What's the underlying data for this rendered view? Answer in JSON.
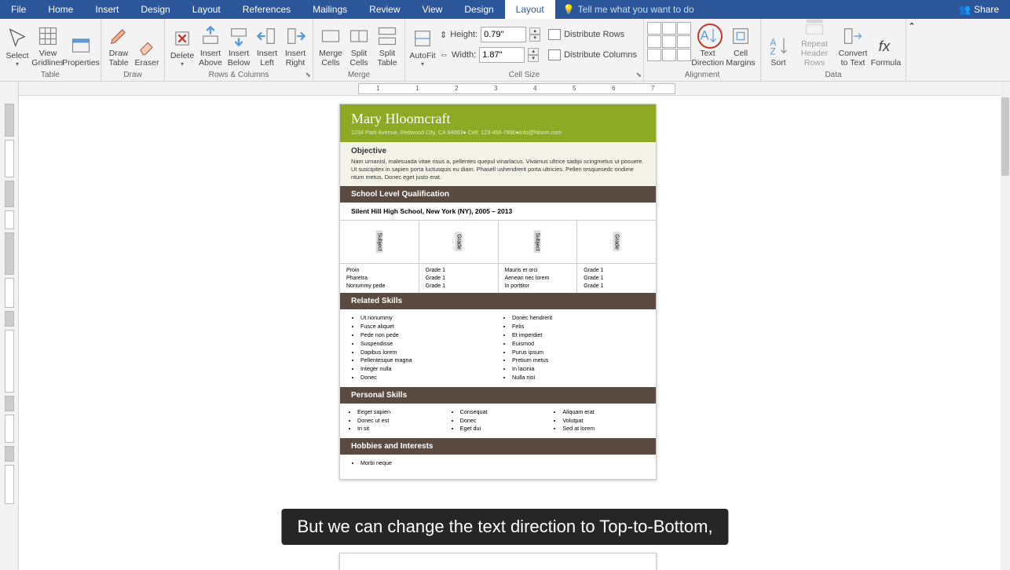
{
  "menu": {
    "tabs": [
      "File",
      "Home",
      "Insert",
      "Design",
      "Layout",
      "References",
      "Mailings",
      "Review",
      "View",
      "Design",
      "Layout"
    ],
    "tellme": "Tell me what you want to do",
    "share": "Share"
  },
  "ribbon": {
    "table": {
      "select": "Select",
      "gridlines": "View\nGridlines",
      "properties": "Properties",
      "label": "Table"
    },
    "draw": {
      "draw": "Draw\nTable",
      "eraser": "Eraser",
      "label": "Draw"
    },
    "rowscols": {
      "delete": "Delete",
      "above": "Insert\nAbove",
      "below": "Insert\nBelow",
      "left": "Insert\nLeft",
      "right": "Insert\nRight",
      "label": "Rows & Columns"
    },
    "merge": {
      "merge": "Merge\nCells",
      "split": "Split\nCells",
      "splittbl": "Split\nTable",
      "label": "Merge"
    },
    "cellsize": {
      "autofit": "AutoFit",
      "height": "Height:",
      "width": "Width:",
      "h_val": "0.79\"",
      "w_val": "1.87\"",
      "distrows": "Distribute Rows",
      "distcols": "Distribute Columns",
      "label": "Cell Size"
    },
    "align": {
      "textdir": "Text\nDirection",
      "margins": "Cell\nMargins",
      "label": "Alignment"
    },
    "data": {
      "sort": "Sort",
      "repeat": "Repeat\nHeader Rows",
      "convert": "Convert\nto Text",
      "formula": "Formula",
      "label": "Data"
    }
  },
  "ruler": {
    "marks": [
      "1",
      "1",
      "2",
      "3",
      "4",
      "5",
      "6",
      "7"
    ]
  },
  "doc": {
    "name": "Mary Hloomcraft",
    "contact": "1234 Park Avenue, Redwood City, CA 94063● Cell: 123-456-7890●info@hloom.com",
    "objective_h": "Objective",
    "objective": "Nam urnanisl, malesuada vitae risus a, pellentes quepul vinarlacus. Vivamus ultrice sadipi scingmetus ut posuere. Ut suscipitex in sapien porta luctusquis eu diam. Phasell ushendrerit porta ultricies. Pellen tesquesedc ondime ntum metus. Donec eget justo erat.",
    "school_h": "School Level Qualification",
    "school": "Silent Hill High School, New York (NY), 2005 – 2013",
    "th": [
      "Subject",
      "Grade",
      "Subject",
      "Grade"
    ],
    "row1": [
      "Proin\nPharetra\nNonummy pede",
      "Grade 1\nGrade 1\nGrade 1",
      "Mauris et orci\nAenean nec lorem\nIn porttitor",
      "Grade 1\nGrade 1\nGrade 1"
    ],
    "related_h": "Related Skills",
    "sk1": [
      "Ut nonummy",
      "Fusce aliquet",
      "Pede non pede",
      "Suspendisse",
      "Dapibus lorem",
      "Pellentesque magna",
      "Integer nulla",
      "Donec"
    ],
    "sk2": [
      "Donec hendrerit",
      "Felis",
      "Et imperdiet",
      "Euismod",
      "Purus ipsum",
      "Pretium metus",
      "In lacinia",
      "Nulla nisi"
    ],
    "personal_h": "Personal Skills",
    "ps1": [
      "Eeget sapien",
      "Donec ut est",
      "In sit"
    ],
    "ps2": [
      "Consequat",
      "Donec",
      "Eget dui"
    ],
    "ps3": [
      "Aliquam erat",
      "Volutpat",
      "Sed at lorem"
    ],
    "hobbies_h": "Hobbies and Interests",
    "hob": [
      "Morbi neque"
    ]
  },
  "caption": "But we can change the text direction to Top-to-Bottom,"
}
